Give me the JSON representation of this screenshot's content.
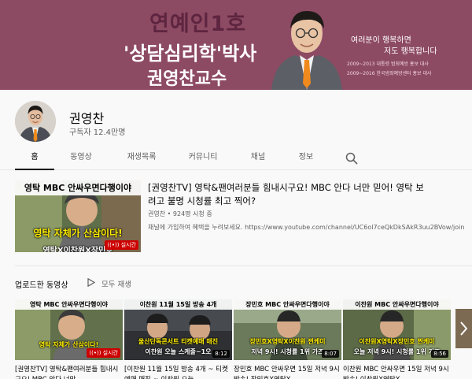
{
  "banner": {
    "line1": "연예인1호",
    "line2": "'상담심리학'박사",
    "line3": "권영찬교수",
    "motto_line1": "여러분이 행복하면",
    "motto_line2": "저도 행복합니다",
    "career1": "2009~2013 대통령 범죄예방 홍보 대사",
    "career2": "2009~2016 한국범죄예방센터 홍보 대사",
    "colors": {
      "background": "#8d4a63",
      "accent": "#5e2540"
    }
  },
  "channel": {
    "name": "권영찬",
    "subscribers": "구독자 12.4만명"
  },
  "tabs": [
    {
      "label": "홈",
      "active": true
    },
    {
      "label": "동영상",
      "active": false
    },
    {
      "label": "재생목록",
      "active": false
    },
    {
      "label": "커뮤니티",
      "active": false
    },
    {
      "label": "채널",
      "active": false
    },
    {
      "label": "정보",
      "active": false
    }
  ],
  "search_icon": "search-icon",
  "featured": {
    "title": "[권영찬TV] 영탁&팬여러분들 힘내시구요! MBC 안다 너만 믿어! 영탁 보려고 불명 시청률 최고 찍어?",
    "meta": "권영찬 • 924명 시청 중",
    "description": "채널에 가입하여 혜택을 누려보세요. https://www.youtube.com/channel/UC6ol7ceQkDkSAkR3uu2BVow/join",
    "thumb_top": "영탁 MBC 안싸우면다행이야",
    "thumb_mid": "영탁 자체가 산삼이다!",
    "thumb_bot": "영탁X이찬원X장민호",
    "badge": "실시간"
  },
  "uploads": {
    "title": "업로드한 동영상",
    "play_all": "모두 재생",
    "videos": [
      {
        "thumb_top": "영탁 MBC 안싸우면다행이야",
        "thumb_mid": "영탁 자체가 산삼이다!",
        "thumb_bot": "",
        "badge": "실시간",
        "title": "[권영찬TV] 영탁&팬여러분들 힘내시구요! MBC 안다 너만"
      },
      {
        "thumb_top": "이찬원 11월 15일 방송 4개",
        "thumb_mid": "울산단독콘서트 티켓예매 매진",
        "thumb_bot": "이찬원 오늘 스케줄~1오",
        "badge": "8:12",
        "title": "[이찬원 11월 15일 방송 4개 ~ 티켓 예매 매진 ~ 이찬원 오늘"
      },
      {
        "thumb_top": "장민호 MBC 안싸우면다행이야",
        "thumb_mid": "장민호X영탁X이찬원 찐케미",
        "thumb_bot": "저녁 9시! 시청률 1위 가즈",
        "badge": "8:07",
        "title": "장민호 MBC 안싸우면 15일 저녁 9시 방송! 장민호X영탁X"
      },
      {
        "thumb_top": "이찬원 MBC 안싸우면다행이야",
        "thumb_mid": "이찬원X영탁X장민호 찐케미",
        "thumb_bot": "오늘 저녁 9시! 시청률 1위 가즈",
        "badge": "8:56",
        "title": "이찬원 MBC 안싸우면 15일 저녁 9시 방송! 이찬원X영탁X"
      }
    ]
  }
}
